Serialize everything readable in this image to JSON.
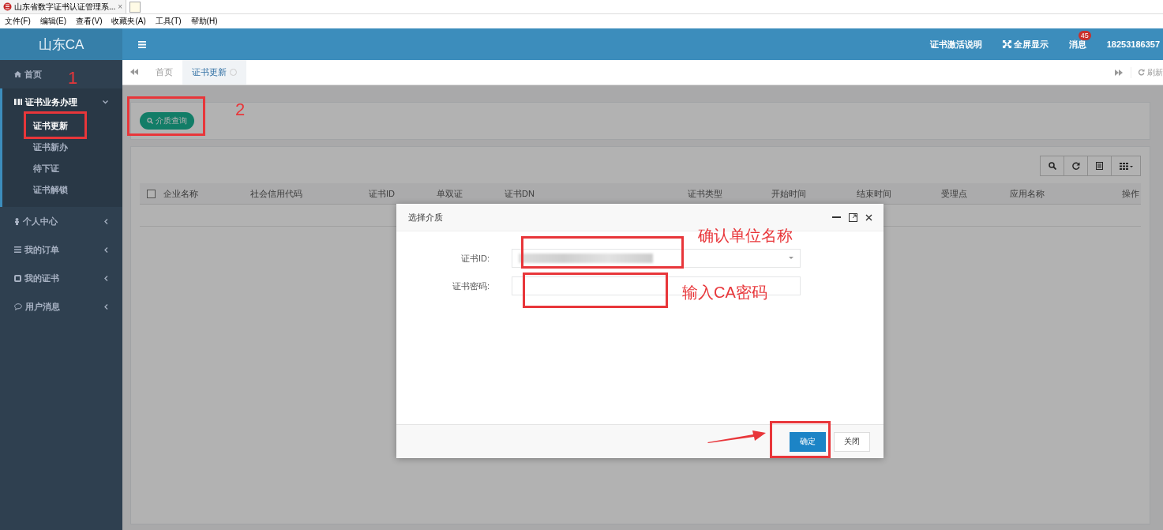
{
  "browser": {
    "tab_title": "山东省数字证书认证管理系...",
    "tab_close": "×",
    "menu": [
      "文件(F)",
      "编辑(E)",
      "查看(V)",
      "收藏夹(A)",
      "工具(T)",
      "帮助(H)"
    ]
  },
  "header": {
    "logo": "山东CA",
    "links": [
      {
        "label": "证书激活说明",
        "kind": "text"
      },
      {
        "label": "全屏显示",
        "kind": "fullscreen"
      },
      {
        "label": "消息",
        "kind": "badge",
        "badge": "45"
      },
      {
        "label": "18253186357",
        "kind": "text"
      }
    ]
  },
  "sidebar": {
    "items": [
      {
        "label": "首页"
      },
      {
        "label": "证书业务办理",
        "expanded": true,
        "children": [
          {
            "label": "证书更新",
            "selected": true
          },
          {
            "label": "证书新办",
            "selected": false
          },
          {
            "label": "待下证",
            "selected": false
          },
          {
            "label": "证书解锁",
            "selected": false
          }
        ]
      },
      {
        "label": "个人中心",
        "expanded": false
      },
      {
        "label": "我的订单",
        "expanded": false
      },
      {
        "label": "我的证书",
        "expanded": false
      },
      {
        "label": "用户消息",
        "expanded": false
      }
    ]
  },
  "tabs": {
    "items": [
      {
        "label": "首页",
        "selected": false,
        "closable": false
      },
      {
        "label": "证书更新",
        "selected": true,
        "closable": true
      }
    ],
    "refresh": "刷新"
  },
  "toolbar": {
    "button": "介质查询"
  },
  "table": {
    "select_all_checked": false,
    "columns": [
      "企业名称",
      "社会信用代码",
      "证书ID",
      "单双证",
      "证书DN",
      "证书类型",
      "开始时间",
      "结束时间",
      "受理点",
      "应用名称",
      "操作"
    ]
  },
  "dialog": {
    "title": "选择介质",
    "fields": [
      {
        "label": "证书ID:",
        "kind": "select",
        "redacted": true
      },
      {
        "label": "证书密码:",
        "kind": "password"
      }
    ],
    "buttons": [
      {
        "label": "确定",
        "primary": true
      },
      {
        "label": "关闭",
        "primary": false
      }
    ]
  },
  "annotations": [
    {
      "kind": "number",
      "text": "1"
    },
    {
      "kind": "box"
    },
    {
      "kind": "number",
      "text": "2"
    },
    {
      "kind": "box"
    },
    {
      "kind": "text",
      "text": "确认单位名称"
    },
    {
      "kind": "box"
    },
    {
      "kind": "text",
      "text": "输入CA密码"
    },
    {
      "kind": "box"
    },
    {
      "kind": "box"
    },
    {
      "kind": "arrow"
    }
  ]
}
